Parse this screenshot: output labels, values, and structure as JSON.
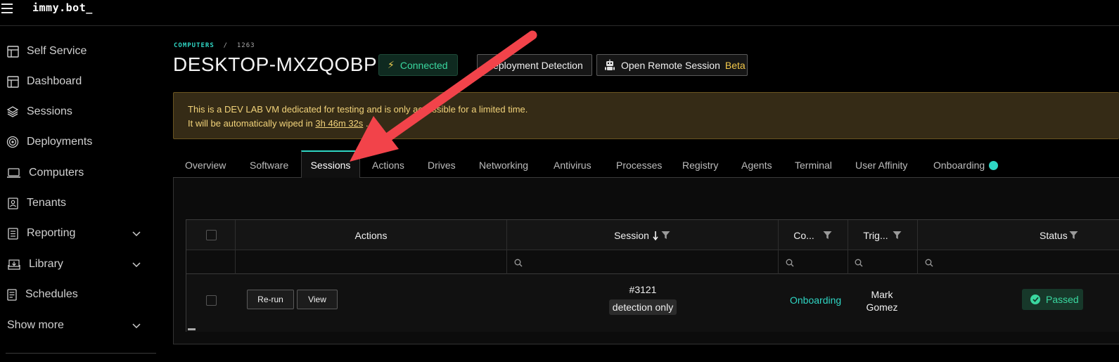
{
  "app": {
    "brand": "immy.bot_"
  },
  "sidebar": {
    "items": [
      {
        "label": "Self Service",
        "icon": "layout-icon"
      },
      {
        "label": "Dashboard",
        "icon": "layout-icon"
      },
      {
        "label": "Sessions",
        "icon": "layers-icon"
      },
      {
        "label": "Deployments",
        "icon": "target-icon"
      },
      {
        "label": "Computers",
        "icon": "laptop-icon"
      },
      {
        "label": "Tenants",
        "icon": "contact-icon"
      },
      {
        "label": "Reporting",
        "icon": "report-icon",
        "expandable": true
      },
      {
        "label": "Library",
        "icon": "download-tray-icon",
        "expandable": true
      },
      {
        "label": "Schedules",
        "icon": "schedule-icon"
      },
      {
        "label": "Show more",
        "expandable": true
      }
    ]
  },
  "breadcrumb": {
    "section": "COMPUTERS",
    "separator": "/",
    "id": "1263"
  },
  "computer": {
    "name": "DESKTOP-MXZQOBP",
    "status": "Connected"
  },
  "actions": {
    "detection_label": "Deployment Detection",
    "remote_label": "Open Remote Session",
    "remote_badge": "Beta"
  },
  "alert": {
    "line1": "This is a DEV LAB VM dedicated for testing and is only accessible for a limited time.",
    "line2_prefix": "It will be automatically wiped in",
    "timer": "3h 46m 32s",
    "line2_suffix": "."
  },
  "tabs": [
    "Overview",
    "Software",
    "Sessions",
    "Actions",
    "Drives",
    "Networking",
    "Antivirus",
    "Processes",
    "Registry",
    "Agents",
    "Terminal",
    "User Affinity",
    "Onboarding"
  ],
  "active_tab": "Sessions",
  "table": {
    "columns": {
      "actions": "Actions",
      "session": "Session",
      "computer": "Co...",
      "trigger": "Trig...",
      "status": "Status"
    },
    "rows": [
      {
        "rerun_label": "Re-run",
        "view_label": "View",
        "session_id": "#3121",
        "session_tag": "detection only",
        "onboarding": "Onboarding",
        "trigger_first": "Mark",
        "trigger_last": "Gomez",
        "status": "Passed"
      }
    ]
  },
  "colors": {
    "accent": "#2fd6c4",
    "success": "#3ad8a0",
    "warning_text": "#f2d37a",
    "arrow": "#f2434a"
  }
}
